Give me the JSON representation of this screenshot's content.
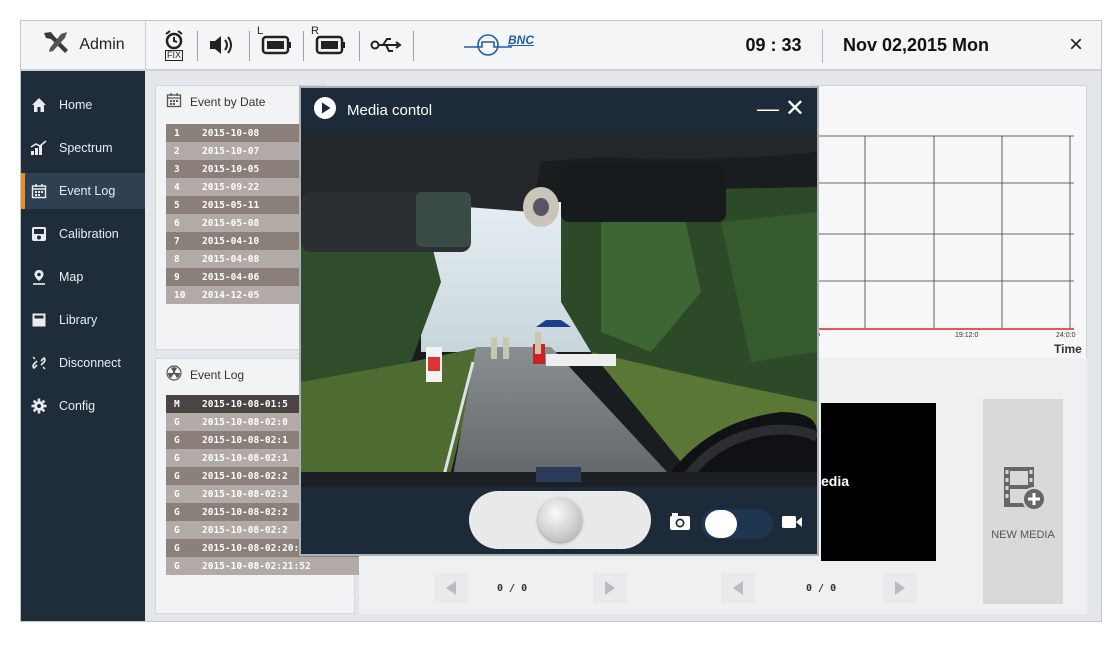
{
  "topbar": {
    "user": "Admin",
    "fix_label": "FIX",
    "left_label": "L",
    "right_label": "R",
    "bnc_label": "BNC",
    "time": "09 : 33",
    "date": "Nov 02,2015 Mon",
    "close": "×"
  },
  "sidebar": {
    "items": [
      {
        "label": "Home",
        "icon": "home-icon"
      },
      {
        "label": "Spectrum",
        "icon": "spectrum-icon"
      },
      {
        "label": "Event Log",
        "icon": "calendar-icon",
        "active": true
      },
      {
        "label": "Calibration",
        "icon": "calibration-icon"
      },
      {
        "label": "Map",
        "icon": "map-pin-icon"
      },
      {
        "label": "Library",
        "icon": "library-icon"
      },
      {
        "label": "Disconnect",
        "icon": "disconnect-icon"
      },
      {
        "label": "Config",
        "icon": "gear-icon"
      }
    ]
  },
  "event_by_date": {
    "title": "Event by Date",
    "rows": [
      {
        "num": "1",
        "date": "2015-10-08"
      },
      {
        "num": "2",
        "date": "2015-10-07"
      },
      {
        "num": "3",
        "date": "2015-10-05"
      },
      {
        "num": "4",
        "date": "2015-09-22"
      },
      {
        "num": "5",
        "date": "2015-05-11"
      },
      {
        "num": "6",
        "date": "2015-05-08"
      },
      {
        "num": "7",
        "date": "2015-04-10"
      },
      {
        "num": "8",
        "date": "2015-04-08"
      },
      {
        "num": "9",
        "date": "2015-04-06"
      },
      {
        "num": "10",
        "date": "2014-12-05"
      }
    ]
  },
  "event_log": {
    "title": "Event Log",
    "rows": [
      {
        "type": "M",
        "time": "2015-10-08-01:5"
      },
      {
        "type": "G",
        "time": "2015-10-08-02:0"
      },
      {
        "type": "G",
        "time": "2015-10-08-02:1"
      },
      {
        "type": "G",
        "time": "2015-10-08-02:1"
      },
      {
        "type": "G",
        "time": "2015-10-08-02:2"
      },
      {
        "type": "G",
        "time": "2015-10-08-02:2"
      },
      {
        "type": "G",
        "time": "2015-10-08-02:2"
      },
      {
        "type": "G",
        "time": "2015-10-08-02:2"
      },
      {
        "type": "G",
        "time": "2015-10-08-02:20:46"
      },
      {
        "type": "G",
        "time": "2015-10-08-02:21:52"
      }
    ]
  },
  "chart": {
    "tick_left": ":0",
    "tick_mid": "19:12:0",
    "tick_right": "24:0:0",
    "time_label": "Time"
  },
  "pagers": {
    "left": "0 / 0",
    "right": "0 / 0"
  },
  "media_panel": {
    "label_partial": "edia",
    "new_media": "NEW MEDIA"
  },
  "dialog": {
    "title": "Media contol",
    "minimize": "—",
    "close": "✕"
  },
  "colors": {
    "sidebar_bg": "#1f2c3a",
    "active_accent": "#f08a24",
    "dialog_bg": "#1c2a3a",
    "chart_line": "#d9232d"
  }
}
